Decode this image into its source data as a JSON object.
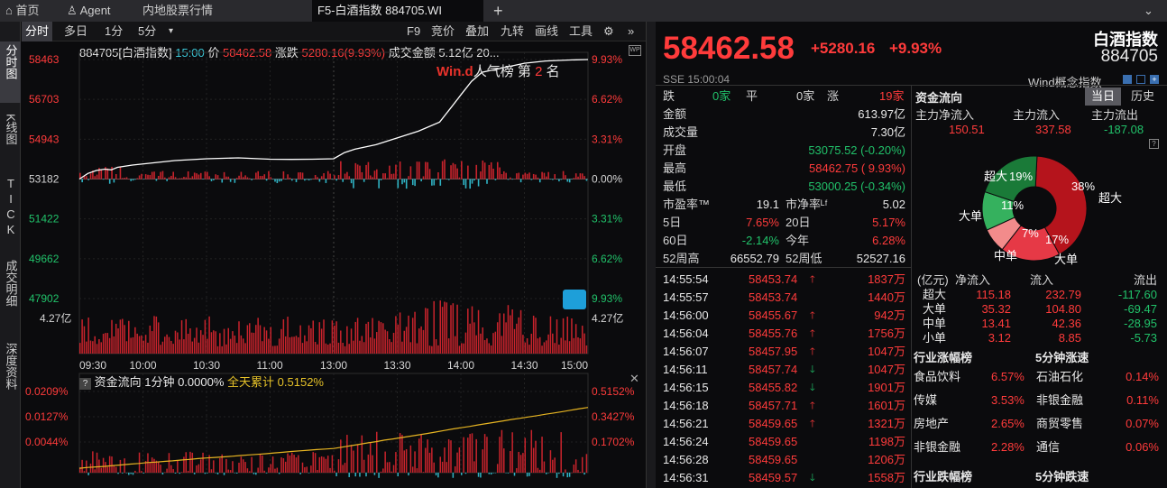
{
  "tabs": [
    {
      "label": "首页"
    },
    {
      "label": "Agent"
    },
    {
      "label": "内地股票行情"
    },
    {
      "label": "F5-白酒指数 884705.WI"
    }
  ],
  "leftnav": [
    "分时图",
    "K线图",
    "TICK",
    "成交明细",
    "深度资料"
  ],
  "toolbar": {
    "left": [
      "分时",
      "多日",
      "1分",
      "5分"
    ],
    "right": [
      "F9",
      "竞价",
      "叠加",
      "九转",
      "画线",
      "工具"
    ]
  },
  "chart_info": {
    "code": "884705[白酒指数]",
    "time": "15:00",
    "price_label": "价",
    "price": "58462.58",
    "change_label": "涨跌",
    "change": "5280.16(9.93%)",
    "amount_label": "成交金额",
    "amount": "5.12亿",
    "extra": "20..."
  },
  "watermark": {
    "brand": "Win.d",
    "text": "人气榜",
    "rank_prefix": "第",
    "rank": "2",
    "rank_suffix": "名"
  },
  "axis": {
    "price_left": [
      "58463",
      "56703",
      "54943",
      "53182",
      "51422",
      "49662",
      "47902"
    ],
    "pct_right": [
      "9.93%",
      "6.62%",
      "3.31%",
      "0.00%",
      "3.31%",
      "6.62%",
      "9.93%"
    ],
    "vol_left": "4.27亿",
    "vol_right": "4.27亿",
    "times": [
      "09:30",
      "10:00",
      "10:30",
      "11:00",
      "13:00",
      "13:30",
      "14:00",
      "14:30",
      "15:00"
    ]
  },
  "flow_panel": {
    "title": "资金流向 1分钟 0.0000%",
    "cum_label": "全天累计",
    "cum_value": "0.5152%",
    "left_ticks": [
      "0.0209%",
      "0.0127%",
      "0.0044%"
    ],
    "right_ticks": [
      "0.5152%",
      "0.3427%",
      "0.1702%"
    ]
  },
  "chart_data": {
    "type": "line",
    "x_range": [
      "09:30",
      "15:00"
    ],
    "ylim": [
      47902,
      58463
    ],
    "prev_close": 53182,
    "price_points": [
      [
        0,
        53182
      ],
      [
        4,
        53430
      ],
      [
        8,
        53560
      ],
      [
        12,
        53620
      ],
      [
        15,
        53590
      ],
      [
        18,
        53700
      ],
      [
        25,
        53800
      ],
      [
        35,
        53900
      ],
      [
        45,
        54000
      ],
      [
        60,
        54080
      ],
      [
        75,
        54120
      ],
      [
        90,
        54060
      ],
      [
        100,
        54050
      ],
      [
        110,
        54060
      ],
      [
        120,
        54080
      ],
      [
        125,
        54350
      ],
      [
        130,
        54500
      ],
      [
        140,
        54700
      ],
      [
        150,
        55000
      ],
      [
        160,
        55300
      ],
      [
        170,
        55700
      ],
      [
        175,
        56300
      ],
      [
        180,
        56900
      ],
      [
        185,
        57500
      ],
      [
        190,
        57900
      ],
      [
        200,
        58100
      ],
      [
        210,
        58300
      ],
      [
        220,
        58400
      ],
      [
        230,
        58440
      ],
      [
        240,
        58462
      ]
    ]
  },
  "quote": {
    "price": "58462.58",
    "change": "+5280.16",
    "pct": "+9.93%",
    "name": "白酒指数",
    "code": "884705",
    "exch": "SSE",
    "time": "15:00:04",
    "wind": "Wind概念指数"
  },
  "breadth": {
    "down_label": "跌",
    "down": "0家",
    "flat_label": "平",
    "flat": "0家",
    "up_label": "涨",
    "up": "19家"
  },
  "stats": [
    {
      "k": "金额",
      "v": "613.97亿",
      "c": "wht"
    },
    {
      "k": "成交量",
      "v": "7.30亿",
      "c": "wht"
    },
    {
      "k": "开盘",
      "v": "53075.52 (-0.20%)",
      "c": "grn"
    },
    {
      "k": "最高",
      "v": "58462.75 ( 9.93%)",
      "c": "red"
    },
    {
      "k": "最低",
      "v": "53000.25 (-0.34%)",
      "c": "grn"
    }
  ],
  "ratios": {
    "pe_label": "市盈率™",
    "pe": "19.1",
    "pb_label": "市净率ᴸᶠ",
    "pb": "5.02",
    "d5_label": "5日",
    "d5": "7.65%",
    "d20_label": "20日",
    "d20": "5.17%",
    "d60_label": "60日",
    "d60": "-2.14%",
    "ytd_label": "今年",
    "ytd": "6.28%",
    "h52_label": "52周高",
    "h52": "66552.79",
    "l52_label": "52周低",
    "l52": "52527.16"
  },
  "ticks": [
    {
      "t": "14:55:54",
      "p": "58453.74",
      "a": "up",
      "v": "1837万"
    },
    {
      "t": "14:55:57",
      "p": "58453.74",
      "a": "",
      "v": "1440万"
    },
    {
      "t": "14:56:00",
      "p": "58455.67",
      "a": "up",
      "v": "942万"
    },
    {
      "t": "14:56:04",
      "p": "58455.76",
      "a": "up",
      "v": "1756万"
    },
    {
      "t": "14:56:07",
      "p": "58457.95",
      "a": "up",
      "v": "1047万"
    },
    {
      "t": "14:56:11",
      "p": "58457.74",
      "a": "down",
      "v": "1047万"
    },
    {
      "t": "14:56:15",
      "p": "58455.82",
      "a": "down",
      "v": "1901万"
    },
    {
      "t": "14:56:18",
      "p": "58457.71",
      "a": "up",
      "v": "1601万"
    },
    {
      "t": "14:56:21",
      "p": "58459.65",
      "a": "up",
      "v": "1321万"
    },
    {
      "t": "14:56:24",
      "p": "58459.65",
      "a": "",
      "v": "1198万"
    },
    {
      "t": "14:56:28",
      "p": "58459.65",
      "a": "",
      "v": "1206万"
    },
    {
      "t": "14:56:31",
      "p": "58459.57",
      "a": "down",
      "v": "1558万"
    }
  ],
  "fund": {
    "title": "资金流向",
    "btn_today": "当日",
    "btn_hist": "历史",
    "h1": "主力净流入",
    "h2": "主力流入",
    "h3": "主力流出",
    "v1": "150.51",
    "v2": "337.58",
    "v3": "-187.08"
  },
  "pie": {
    "labels": [
      {
        "t": "超大",
        "p": "38%"
      },
      {
        "t": "大单",
        "p": "17%"
      },
      {
        "t": "中单",
        "p": "7%"
      },
      {
        "t": "大单",
        "p": "11%"
      },
      {
        "t": "超大",
        "p": "19%"
      }
    ],
    "slices": [
      38,
      17,
      7,
      11,
      19
    ],
    "colors": [
      "#b5141c",
      "#e63946",
      "#f28b8b",
      "#35b15e",
      "#1a7a38"
    ]
  },
  "flow_table": {
    "head": [
      "(亿元)",
      "净流入",
      "流入",
      "流出"
    ],
    "rows": [
      [
        "超大",
        "115.18",
        "232.79",
        "-117.60"
      ],
      [
        "大单",
        "35.32",
        "104.80",
        "-69.47"
      ],
      [
        "中单",
        "13.41",
        "42.36",
        "-28.95"
      ],
      [
        "小单",
        "3.12",
        "8.85",
        "-5.73"
      ]
    ]
  },
  "industry": {
    "t1": "行业涨幅榜",
    "t2": "5分钟涨速",
    "rows": [
      [
        "食品饮料",
        "6.57%",
        "石油石化",
        "0.14%"
      ],
      [
        "传媒",
        "3.53%",
        "非银金融",
        "0.11%"
      ],
      [
        "房地产",
        "2.65%",
        "商贸零售",
        "0.07%"
      ],
      [
        "非银金融",
        "2.28%",
        "通信",
        "0.06%"
      ]
    ],
    "t3": "行业跌幅榜",
    "t4": "5分钟跌速"
  }
}
